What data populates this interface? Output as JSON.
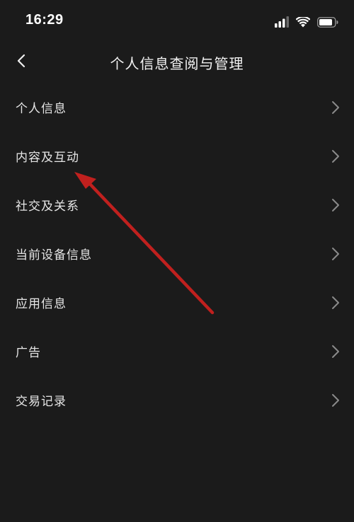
{
  "status_bar": {
    "time": "16:29",
    "icons": [
      "cellular-signal-icon",
      "wifi-icon",
      "battery-icon"
    ]
  },
  "header": {
    "title": "个人信息查阅与管理",
    "back_icon": "chevron-left-icon"
  },
  "menu": {
    "items": [
      {
        "label": "个人信息"
      },
      {
        "label": "内容及互动"
      },
      {
        "label": "社交及关系"
      },
      {
        "label": "当前设备信息"
      },
      {
        "label": "应用信息"
      },
      {
        "label": "广告"
      },
      {
        "label": "交易记录"
      }
    ],
    "item_icon": "chevron-right-icon"
  },
  "annotation": {
    "color": "#c0201e",
    "points_to": "内容及互动"
  },
  "colors": {
    "background": "#1b1b1b",
    "text": "#e6e6e6",
    "chevron": "#8a8a8a"
  }
}
